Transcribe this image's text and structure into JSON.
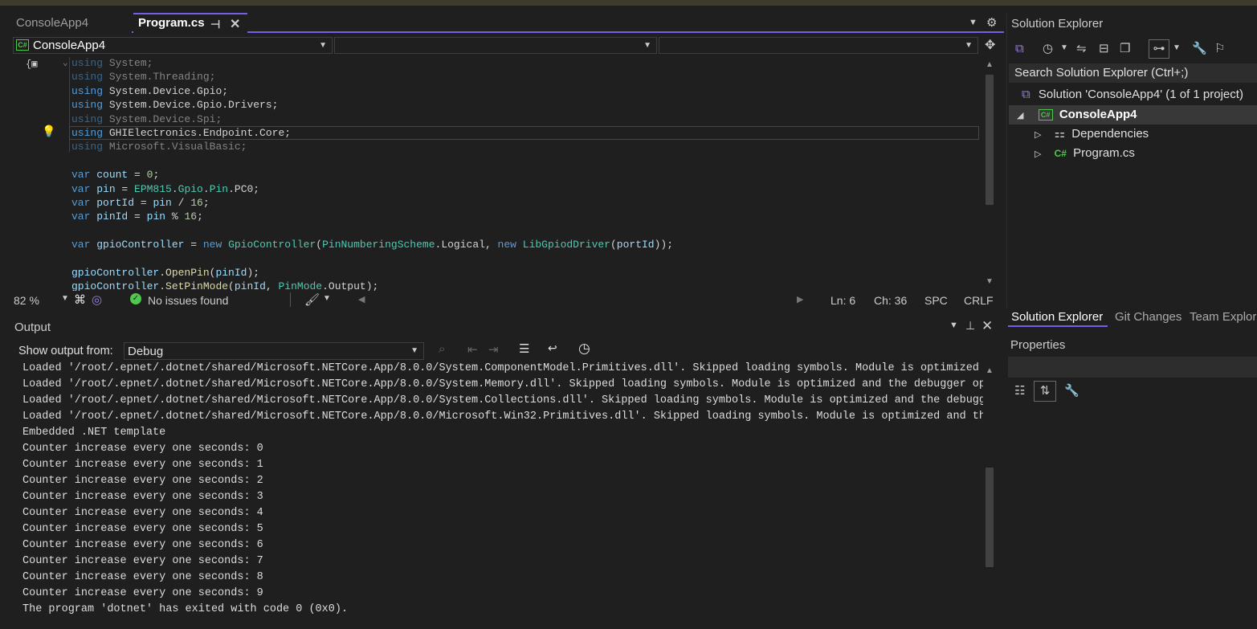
{
  "tabs": [
    {
      "label": "ConsoleApp4"
    },
    {
      "label": "Program.cs"
    }
  ],
  "navbar": {
    "project": "ConsoleApp4"
  },
  "code": [
    {
      "tokens": [
        [
          "kw",
          "using"
        ],
        [
          "pl",
          " System;"
        ]
      ],
      "dim": true
    },
    {
      "tokens": [
        [
          "kw",
          "using"
        ],
        [
          "pl",
          " System.Threading;"
        ]
      ],
      "dim": true
    },
    {
      "tokens": [
        [
          "kw",
          "using"
        ],
        [
          "pl",
          " System.Device.Gpio;"
        ]
      ],
      "dim": false
    },
    {
      "tokens": [
        [
          "kw",
          "using"
        ],
        [
          "pl",
          " System.Device.Gpio.Drivers;"
        ]
      ],
      "dim": false
    },
    {
      "tokens": [
        [
          "kw",
          "using"
        ],
        [
          "pl",
          " System.Device.Spi;"
        ]
      ],
      "dim": true
    },
    {
      "tokens": [
        [
          "kw",
          "using"
        ],
        [
          "pl",
          " GHIElectronics.Endpoint.Core;"
        ]
      ],
      "dim": false
    },
    {
      "tokens": [
        [
          "kw",
          "using"
        ],
        [
          "pl",
          " Microsoft.VisualBasic;"
        ]
      ],
      "dim": true
    },
    {
      "tokens": [],
      "dim": false
    },
    {
      "tokens": [
        [
          "kw",
          "var"
        ],
        [
          "pl",
          " "
        ],
        [
          "id",
          "count"
        ],
        [
          "pl",
          " = "
        ],
        [
          "nm",
          "0"
        ],
        [
          "pl",
          ";"
        ]
      ],
      "dim": false
    },
    {
      "tokens": [
        [
          "kw",
          "var"
        ],
        [
          "pl",
          " "
        ],
        [
          "id",
          "pin"
        ],
        [
          "pl",
          " = "
        ],
        [
          "ty",
          "EPM815"
        ],
        [
          "pl",
          "."
        ],
        [
          "ty",
          "Gpio"
        ],
        [
          "pl",
          "."
        ],
        [
          "ty",
          "Pin"
        ],
        [
          "pl",
          ".PC0;"
        ]
      ],
      "dim": false
    },
    {
      "tokens": [
        [
          "kw",
          "var"
        ],
        [
          "pl",
          " "
        ],
        [
          "id",
          "portId"
        ],
        [
          "pl",
          " = "
        ],
        [
          "id",
          "pin"
        ],
        [
          "pl",
          " / "
        ],
        [
          "nm",
          "16"
        ],
        [
          "pl",
          ";"
        ]
      ],
      "dim": false
    },
    {
      "tokens": [
        [
          "kw",
          "var"
        ],
        [
          "pl",
          " "
        ],
        [
          "id",
          "pinId"
        ],
        [
          "pl",
          " = "
        ],
        [
          "id",
          "pin"
        ],
        [
          "pl",
          " % "
        ],
        [
          "nm",
          "16"
        ],
        [
          "pl",
          ";"
        ]
      ],
      "dim": false
    },
    {
      "tokens": [],
      "dim": false
    },
    {
      "tokens": [
        [
          "kw",
          "var"
        ],
        [
          "pl",
          " "
        ],
        [
          "id",
          "gpioController"
        ],
        [
          "pl",
          " = "
        ],
        [
          "kw",
          "new"
        ],
        [
          "pl",
          " "
        ],
        [
          "ty",
          "GpioController"
        ],
        [
          "pl",
          "("
        ],
        [
          "ty",
          "PinNumberingScheme"
        ],
        [
          "pl",
          ".Logical, "
        ],
        [
          "kw",
          "new"
        ],
        [
          "pl",
          " "
        ],
        [
          "ty",
          "LibGpiodDriver"
        ],
        [
          "pl",
          "("
        ],
        [
          "id",
          "portId"
        ],
        [
          "pl",
          "));"
        ]
      ],
      "dim": false
    },
    {
      "tokens": [],
      "dim": false
    },
    {
      "tokens": [
        [
          "id",
          "gpioController"
        ],
        [
          "pl",
          "."
        ],
        [
          "fn",
          "OpenPin"
        ],
        [
          "pl",
          "("
        ],
        [
          "id",
          "pinId"
        ],
        [
          "pl",
          ");"
        ]
      ],
      "dim": false
    },
    {
      "tokens": [
        [
          "id",
          "gpioController"
        ],
        [
          "pl",
          "."
        ],
        [
          "fn",
          "SetPinMode"
        ],
        [
          "pl",
          "("
        ],
        [
          "id",
          "pinId"
        ],
        [
          "pl",
          ", "
        ],
        [
          "ty",
          "PinMode"
        ],
        [
          "pl",
          ".Output);"
        ]
      ],
      "dim": false
    }
  ],
  "editor_status": {
    "zoom": "82 %",
    "issues": "No issues found",
    "ln": "Ln: 6",
    "ch": "Ch: 36",
    "spc": "SPC",
    "crlf": "CRLF"
  },
  "output": {
    "title": "Output",
    "show_from_label": "Show output from:",
    "source": "Debug",
    "lines": [
      "Loaded '/root/.epnet/.dotnet/shared/Microsoft.NETCore.App/8.0.0/System.ComponentModel.Primitives.dll'. Skipped loading symbols. Module is optimized a",
      "Loaded '/root/.epnet/.dotnet/shared/Microsoft.NETCore.App/8.0.0/System.Memory.dll'. Skipped loading symbols. Module is optimized and the debugger opt",
      "Loaded '/root/.epnet/.dotnet/shared/Microsoft.NETCore.App/8.0.0/System.Collections.dll'. Skipped loading symbols. Module is optimized and the debugge",
      "Loaded '/root/.epnet/.dotnet/shared/Microsoft.NETCore.App/8.0.0/Microsoft.Win32.Primitives.dll'. Skipped loading symbols. Module is optimized and the",
      "Embedded .NET template",
      "Counter increase every one seconds: 0",
      "Counter increase every one seconds: 1",
      "Counter increase every one seconds: 2",
      "Counter increase every one seconds: 3",
      "Counter increase every one seconds: 4",
      "Counter increase every one seconds: 5",
      "Counter increase every one seconds: 6",
      "Counter increase every one seconds: 7",
      "Counter increase every one seconds: 8",
      "Counter increase every one seconds: 9",
      "The program 'dotnet' has exited with code 0 (0x0)."
    ]
  },
  "solution_explorer": {
    "title": "Solution Explorer",
    "search_placeholder": "Search Solution Explorer (Ctrl+;)",
    "solution": "Solution 'ConsoleApp4' (1 of 1 project)",
    "project": "ConsoleApp4",
    "items": [
      {
        "label": "Dependencies"
      },
      {
        "label": "Program.cs"
      }
    ],
    "bottom_tabs": [
      {
        "label": "Solution Explorer"
      },
      {
        "label": "Git Changes"
      },
      {
        "label": "Team Explor"
      }
    ]
  },
  "properties": {
    "title": "Properties"
  }
}
